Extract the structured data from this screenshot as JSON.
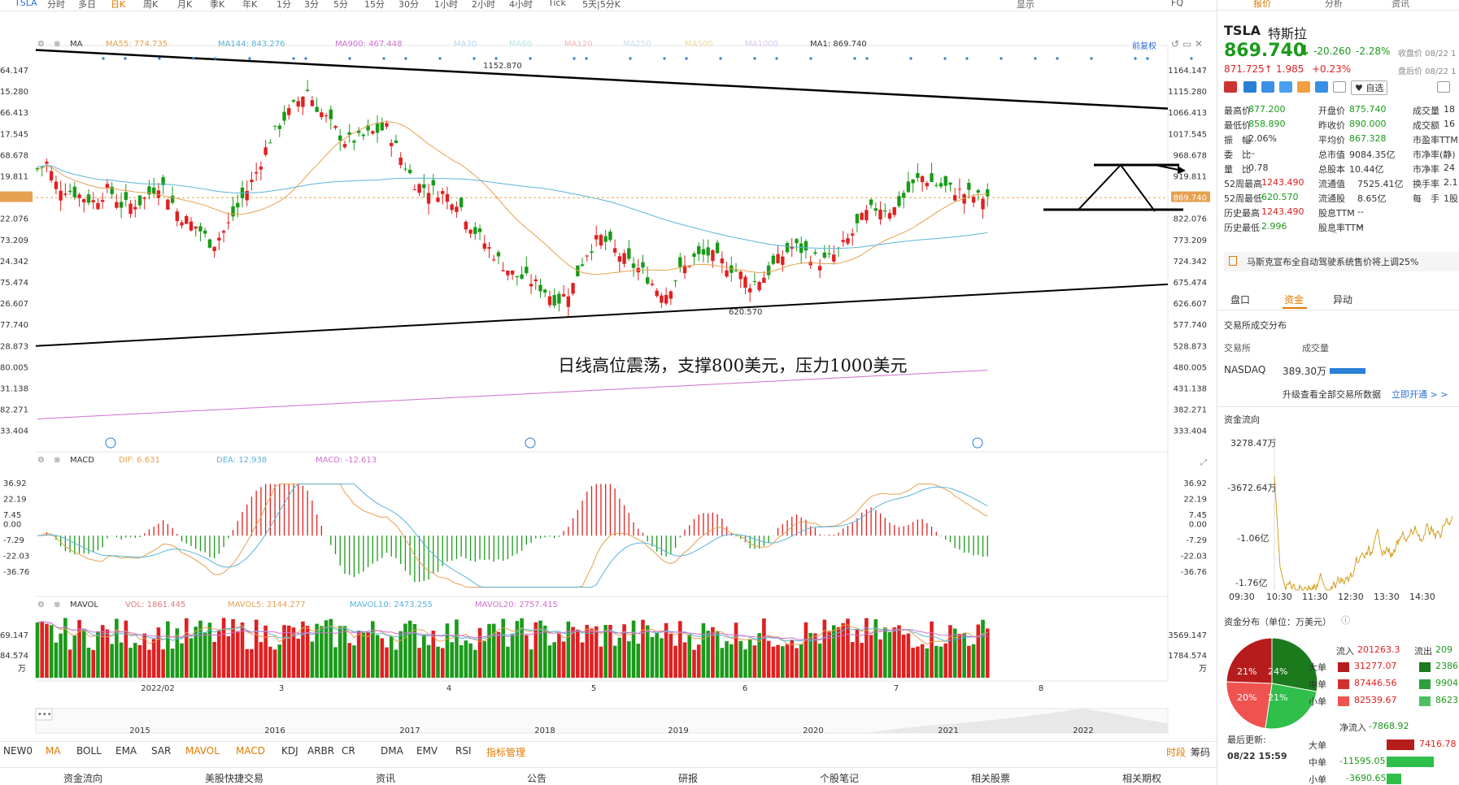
{
  "toolbar": {
    "ticker_tab": "TSLA",
    "periods": [
      "分时",
      "多日",
      "日K",
      "周K",
      "月K",
      "季K",
      "年K",
      "1分",
      "3分",
      "5分",
      "15分",
      "30分",
      "1小时",
      "2小时",
      "4小时",
      "Tick",
      "5天|5分K"
    ],
    "display": "显示",
    "fq": "FQ"
  },
  "ma": {
    "label": "MA",
    "ma55": "MA55: 774.735",
    "ma144": "MA144: 843.276",
    "ma900": "MA900: 467.448",
    "ma30": "MA30",
    "ma60": "MA60",
    "ma120": "MA120",
    "ma250": "MA250",
    "ma500": "MA500",
    "ma1000": "MA1000",
    "ma1": "MA1: 869.740",
    "adjust": "前复权"
  },
  "price_axis": [
    "1164.147",
    "1115.280",
    "1066.413",
    "1017.545",
    "968.678",
    "919.811",
    "869.740",
    "822.076",
    "773.209",
    "724.342",
    "675.474",
    "626.607",
    "577.740",
    "528.873",
    "480.005",
    "431.138",
    "382.271",
    "333.404"
  ],
  "price_axis_left": [
    "64.147",
    "15.280",
    "66.413",
    "17.545",
    "68.678",
    "19.811",
    "869.740",
    "22.076",
    "73.209",
    "24.342",
    "75.474",
    "26.607",
    "77.740",
    "28.873",
    "80.005",
    "31.138",
    "82.271",
    "33.404"
  ],
  "annotations": {
    "high": "1152.870",
    "low": "620.570",
    "comment": "日线高位震荡，支撑800美元，压力1000美元"
  },
  "macd": {
    "label": "MACD",
    "dif": "DIF: 6.631",
    "dea": "DEA: 12.938",
    "macd": "MACD: -12.613",
    "axis": [
      "36.92",
      "22.19",
      "7.45",
      "0.00",
      "-7.29",
      "-22.03",
      "-36.76"
    ]
  },
  "mavol": {
    "label": "MAVOL",
    "vol": "VOL: 1861.445",
    "mavol5": "MAVOL5: 2144.277",
    "mavol10": "MAVOL10: 2473.255",
    "mavol20": "MAVOL20: 2757.415",
    "axis_r": [
      "3569.147",
      "1784.574",
      "万"
    ],
    "axis_l": [
      "69.147",
      "84.574",
      "万"
    ]
  },
  "date_axis": [
    "2022/02",
    "3",
    "4",
    "5",
    "6",
    "7",
    "8"
  ],
  "overview_years": [
    "2015",
    "2016",
    "2017",
    "2018",
    "2019",
    "2020",
    "2021",
    "2022"
  ],
  "indicator_tabs": [
    "NEW0",
    "MA",
    "BOLL",
    "EMA",
    "SAR",
    "MAVOL",
    "MACD",
    "KDJ",
    "ARBR",
    "CR",
    "DMA",
    "EMV",
    "RSI",
    "指标管理"
  ],
  "indicator_right": [
    "时段",
    "筹码"
  ],
  "bottom_nav": [
    "资金流向",
    "美股快捷交易",
    "资讯",
    "公告",
    "研报",
    "个股笔记",
    "相关股票",
    "相关期权"
  ],
  "quote": {
    "tabs": [
      "报价",
      "分析",
      "资讯"
    ],
    "symbol": "TSLA",
    "name": "特斯拉",
    "price": "869.740",
    "arrow": "↓",
    "change": "-20.260",
    "pct": "-2.28%",
    "close_note": "收盘价 08/22 1",
    "after_price": "871.725↑",
    "after_change": "1.985",
    "after_pct": "+0.23%",
    "after_note": "盘后价 08/22 1",
    "self_select": "自选",
    "stats": [
      [
        "最高价",
        "877.200",
        "开盘价",
        "875.740",
        "成交量",
        "18"
      ],
      [
        "最低价",
        "858.890",
        "昨收价",
        "890.000",
        "成交额",
        "16"
      ],
      [
        "振　幅",
        "2.06%",
        "平均价",
        "867.328",
        "市盈率TTM",
        ""
      ],
      [
        "委　比",
        "--",
        "总市值",
        "9084.35亿",
        "市净率(静)",
        ""
      ],
      [
        "量　比",
        "0.78",
        "总股本",
        "10.44亿",
        "市净率",
        "24"
      ],
      [
        "52周最高",
        "1243.490",
        "流通值",
        "7525.41亿",
        "换手率",
        "2.1"
      ],
      [
        "52周最低",
        "620.570",
        "流通股",
        "8.65亿",
        "每　手",
        "1股"
      ],
      [
        "历史最高",
        "1243.490",
        "股息TTM",
        "--",
        "",
        ""
      ],
      [
        "历史最低",
        "2.996",
        "股息率TTM",
        "--",
        "",
        ""
      ]
    ],
    "news": "马斯克宣布全自动驾驶系统售价将上调25%",
    "tabs2": [
      "盘口",
      "资金",
      "异动"
    ],
    "exchange_title": "交易所成交分布",
    "exchange_head": [
      "交易所",
      "成交量"
    ],
    "exchange_row": [
      "NASDAQ",
      "389.30万"
    ],
    "upgrade": "升级查看全部交易所数据",
    "upgrade_link": "立即开通 > >",
    "flow_title": "资金流向",
    "flow_axis": [
      "3278.47万",
      "-3672.64万",
      "-1.06亿",
      "-1.76亿"
    ],
    "flow_times": [
      "09:30",
      "10:30",
      "11:30",
      "12:30",
      "13:30",
      "14:30"
    ],
    "dist_title": "资金分布（单位：万美元）",
    "pie": [
      "21%",
      "24%",
      "20%",
      "21%"
    ],
    "in_label": "流入",
    "in_total": "201263.3",
    "out_label": "流出",
    "out_total": "209",
    "rows": [
      [
        "大单",
        "31277.07",
        "2386"
      ],
      [
        "中单",
        "87446.56",
        "9904"
      ],
      [
        "小单",
        "82539.67",
        "8623"
      ]
    ],
    "net_label": "净流入",
    "net_total": "-7868.92",
    "net_rows": [
      [
        "大单",
        "7416.78"
      ],
      [
        "中单",
        "-11595.05"
      ],
      [
        "小单",
        "-3690.65"
      ]
    ],
    "updated_label": "最后更新:",
    "updated": "08/22 15:59"
  },
  "colors": {
    "up": "#e02020",
    "down": "#1a9a1a",
    "ma55": "#e6a050",
    "ma144": "#5ab4d6",
    "ma900": "#d070d0",
    "accent": "#e07a00"
  }
}
